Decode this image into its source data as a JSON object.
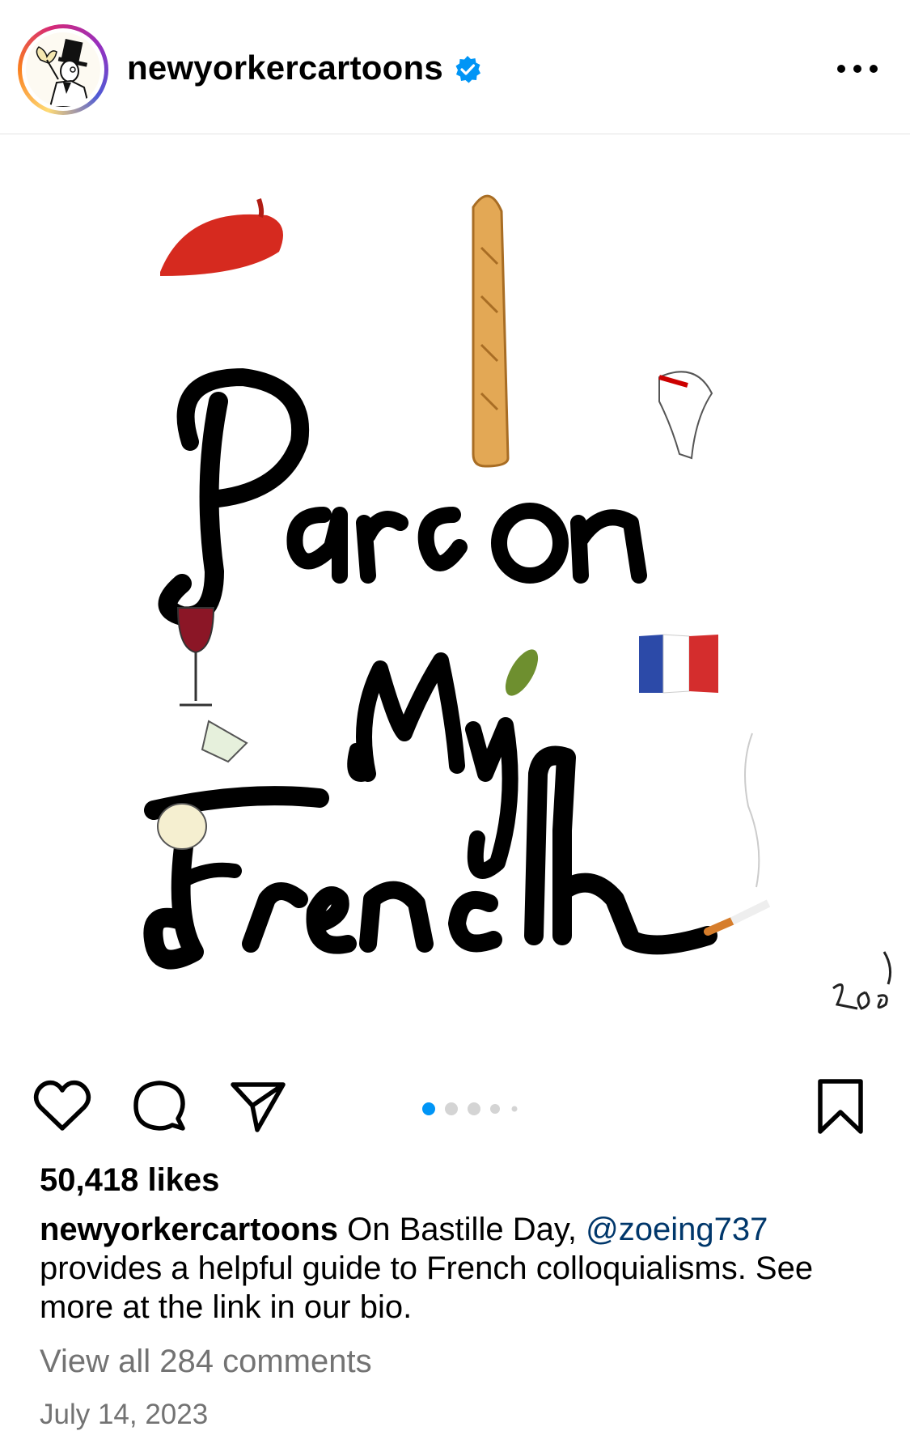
{
  "header": {
    "username": "newyorkercartoons",
    "verified_color": "#0095f6",
    "avatar_icon": "eustace-tilley-icon",
    "more_icon": "more-horizontal-icon"
  },
  "post": {
    "artwork_text": [
      "Pardon",
      "My",
      "French"
    ],
    "signature": "Zoé"
  },
  "actions": {
    "like_icon": "heart-icon",
    "comment_icon": "comment-icon",
    "share_icon": "send-icon",
    "save_icon": "bookmark-icon",
    "carousel_count": 5,
    "carousel_active": 1,
    "active_dot_color": "#0095f6"
  },
  "engagement": {
    "likes": "50,418 likes",
    "caption_user": "newyorkercartoons",
    "caption_text_1": "On Bastille Day,",
    "caption_mention": "@zoeing737",
    "caption_text_2": "provides a helpful guide to French colloquialisms. See more at the link in our bio.",
    "view_comments": "View all 284 comments",
    "date": "July 14, 2023"
  }
}
